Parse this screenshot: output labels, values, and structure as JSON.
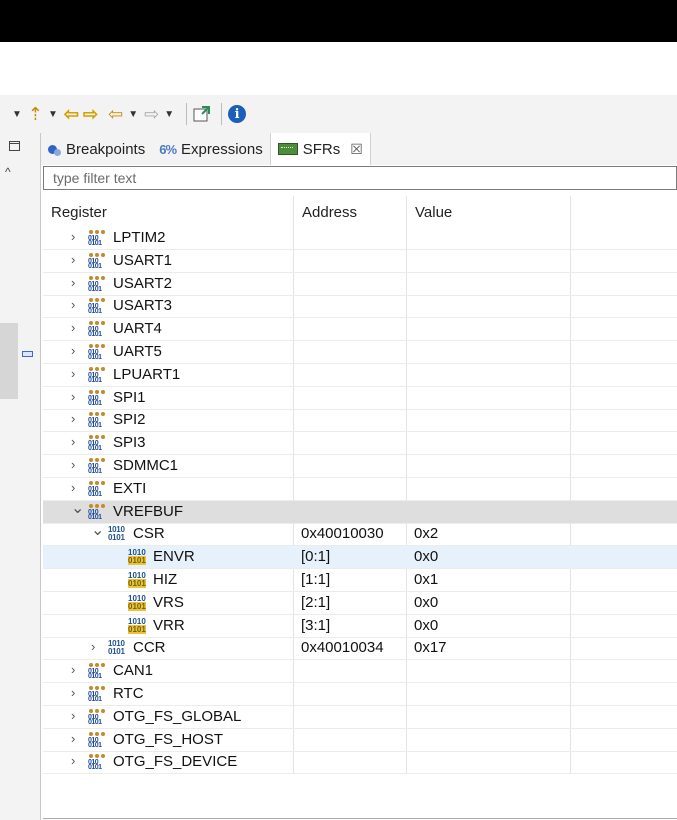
{
  "toolbar": {
    "icons": [
      "step-into-icon",
      "step-over-icon",
      "step-return-icon",
      "back-icon",
      "forward-icon",
      "new-view-icon",
      "info-icon"
    ]
  },
  "tabs": [
    {
      "label": "Breakpoints",
      "icon": "breakpoints-icon"
    },
    {
      "label": "Expressions",
      "icon": "expressions-icon"
    },
    {
      "label": "SFRs",
      "icon": "sfrs-icon",
      "active": true
    }
  ],
  "filter": {
    "placeholder": "type filter text",
    "value": ""
  },
  "columns": {
    "register": "Register",
    "address": "Address",
    "value": "Value"
  },
  "rows": [
    {
      "name": "LPTIM2",
      "level": 0,
      "kind": "peripheral",
      "expanded": false,
      "address": "",
      "value": ""
    },
    {
      "name": "USART1",
      "level": 0,
      "kind": "peripheral",
      "expanded": false,
      "address": "",
      "value": ""
    },
    {
      "name": "USART2",
      "level": 0,
      "kind": "peripheral",
      "expanded": false,
      "address": "",
      "value": ""
    },
    {
      "name": "USART3",
      "level": 0,
      "kind": "peripheral",
      "expanded": false,
      "address": "",
      "value": ""
    },
    {
      "name": "UART4",
      "level": 0,
      "kind": "peripheral",
      "expanded": false,
      "address": "",
      "value": ""
    },
    {
      "name": "UART5",
      "level": 0,
      "kind": "peripheral",
      "expanded": false,
      "address": "",
      "value": ""
    },
    {
      "name": "LPUART1",
      "level": 0,
      "kind": "peripheral",
      "expanded": false,
      "address": "",
      "value": ""
    },
    {
      "name": "SPI1",
      "level": 0,
      "kind": "peripheral",
      "expanded": false,
      "address": "",
      "value": ""
    },
    {
      "name": "SPI2",
      "level": 0,
      "kind": "peripheral",
      "expanded": false,
      "address": "",
      "value": ""
    },
    {
      "name": "SPI3",
      "level": 0,
      "kind": "peripheral",
      "expanded": false,
      "address": "",
      "value": ""
    },
    {
      "name": "SDMMC1",
      "level": 0,
      "kind": "peripheral",
      "expanded": false,
      "address": "",
      "value": ""
    },
    {
      "name": "EXTI",
      "level": 0,
      "kind": "peripheral",
      "expanded": false,
      "address": "",
      "value": ""
    },
    {
      "name": "VREFBUF",
      "level": 0,
      "kind": "peripheral",
      "expanded": true,
      "address": "",
      "value": "",
      "selected": true
    },
    {
      "name": "CSR",
      "level": 1,
      "kind": "register",
      "expanded": true,
      "address": "0x40010030",
      "value": "0x2"
    },
    {
      "name": "ENVR",
      "level": 2,
      "kind": "field",
      "address": "[0:1]",
      "value": "0x0",
      "hilite": true
    },
    {
      "name": "HIZ",
      "level": 2,
      "kind": "field",
      "address": "[1:1]",
      "value": "0x1"
    },
    {
      "name": "VRS",
      "level": 2,
      "kind": "field",
      "address": "[2:1]",
      "value": "0x0"
    },
    {
      "name": "VRR",
      "level": 2,
      "kind": "field",
      "address": "[3:1]",
      "value": "0x0"
    },
    {
      "name": "CCR",
      "level": 1,
      "kind": "register",
      "expanded": false,
      "address": "0x40010034",
      "value": "0x17"
    },
    {
      "name": "CAN1",
      "level": 0,
      "kind": "peripheral",
      "expanded": false,
      "address": "",
      "value": ""
    },
    {
      "name": "RTC",
      "level": 0,
      "kind": "peripheral",
      "expanded": false,
      "address": "",
      "value": ""
    },
    {
      "name": "OTG_FS_GLOBAL",
      "level": 0,
      "kind": "peripheral",
      "expanded": false,
      "address": "",
      "value": ""
    },
    {
      "name": "OTG_FS_HOST",
      "level": 0,
      "kind": "peripheral",
      "expanded": false,
      "address": "",
      "value": ""
    },
    {
      "name": "OTG_FS_DEVICE",
      "level": 0,
      "kind": "peripheral",
      "expanded": false,
      "address": "",
      "value": ""
    }
  ]
}
